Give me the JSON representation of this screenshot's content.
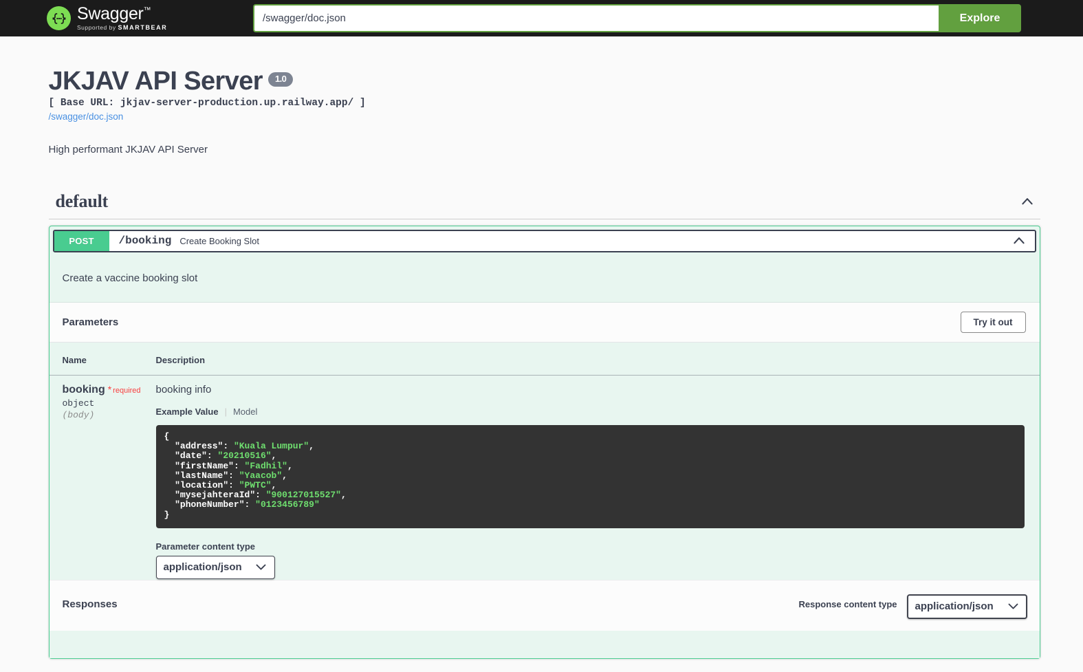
{
  "topbar": {
    "logo_title": "Swagger",
    "logo_tm": "™",
    "logo_supported_prefix": "Supported by",
    "logo_brand": "SMARTBEAR",
    "url_value": "/swagger/doc.json",
    "url_placeholder": "/swagger/doc.json",
    "explore_label": "Explore"
  },
  "info": {
    "title": "JKJAV API Server",
    "version": "1.0",
    "base_url": "[ Base URL: jkjav-server-production.up.railway.app/ ]",
    "doc_link": "/swagger/doc.json",
    "description": "High performant JKJAV API Server"
  },
  "tag": {
    "name": "default",
    "collapse_icon": "chevron-up-icon"
  },
  "operation": {
    "method": "POST",
    "path": "/booking",
    "summary": "Create Booking Slot",
    "description": "Create a vaccine booking slot",
    "toggle_icon": "chevron-up-icon",
    "parameters_title": "Parameters",
    "try_it_out_label": "Try it out",
    "columns": {
      "name": "Name",
      "description": "Description"
    },
    "parameter": {
      "name": "booking",
      "required_star": "*",
      "required_label": "required",
      "type": "object",
      "in": "(body)",
      "description": "booking info",
      "tab_example": "Example Value",
      "tab_divider": "|",
      "tab_model": "Model",
      "example_lines": [
        {
          "indent": 0,
          "text": "{",
          "type": "punct"
        },
        {
          "indent": 1,
          "key": "\"address\"",
          "value": "\"Kuala Lumpur\"",
          "comma": true
        },
        {
          "indent": 1,
          "key": "\"date\"",
          "value": "\"20210516\"",
          "comma": true
        },
        {
          "indent": 1,
          "key": "\"firstName\"",
          "value": "\"Fadhil\"",
          "comma": true
        },
        {
          "indent": 1,
          "key": "\"lastName\"",
          "value": "\"Yaacob\"",
          "comma": true
        },
        {
          "indent": 1,
          "key": "\"location\"",
          "value": "\"PWTC\"",
          "comma": true
        },
        {
          "indent": 1,
          "key": "\"mysejahteraId\"",
          "value": "\"900127015527\"",
          "comma": true
        },
        {
          "indent": 1,
          "key": "\"phoneNumber\"",
          "value": "\"0123456789\"",
          "comma": false
        },
        {
          "indent": 0,
          "text": "}",
          "type": "punct"
        }
      ],
      "content_type_label": "Parameter content type",
      "content_type_value": "application/json",
      "content_type_options": [
        "application/json"
      ]
    }
  },
  "responses": {
    "title": "Responses",
    "content_type_label": "Response content type",
    "content_type_value": "application/json",
    "content_type_options": [
      "application/json"
    ]
  },
  "colors": {
    "brand_green": "#7ddc53",
    "explore_green": "#62a03f",
    "post_green": "#49cc90",
    "opblock_bg": "#e8f6f0",
    "text": "#3b4151",
    "required_red": "#f93e3e",
    "link_blue": "#4990e2",
    "code_bg": "#333333",
    "code_string": "#6fdf6f",
    "version_badge": "#7d8492"
  }
}
